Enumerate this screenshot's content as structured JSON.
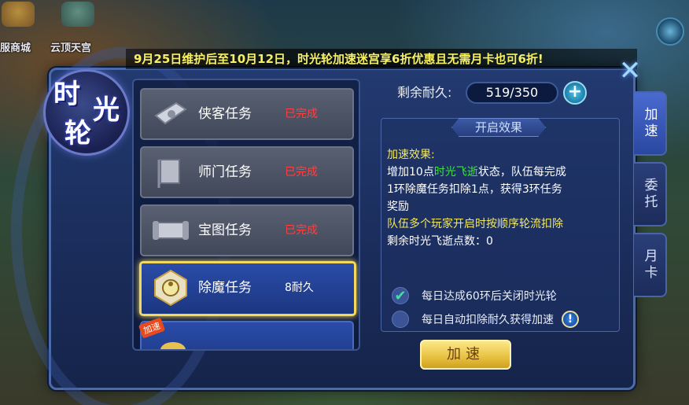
{
  "top_bar": {
    "left_labels": [
      "服商城",
      "云顶天宫"
    ]
  },
  "marquee": "9月25日维护后至10月12日，时光轮加速迷宫享6折优惠且无需月卡也可6折!",
  "title": {
    "chars": [
      "时",
      "光",
      "轮"
    ]
  },
  "tasks": [
    {
      "name": "侠客任务",
      "status": "已完成",
      "icon": "scroll-icon"
    },
    {
      "name": "师门任务",
      "status": "已完成",
      "icon": "banner-icon"
    },
    {
      "name": "宝图任务",
      "status": "已完成",
      "icon": "map-scroll-icon"
    },
    {
      "name": "除魔任务",
      "status": "8耐久",
      "icon": "taiji-icon"
    },
    {
      "name": "",
      "status": "",
      "icon": "gold-item-icon",
      "badge": "加速"
    }
  ],
  "durability": {
    "label": "剩余耐久:",
    "value": "519/350",
    "plus": "+"
  },
  "effect": {
    "title": "开启效果",
    "heading": "加速效果:",
    "line1_prefix": "增加10点",
    "line1_highlight": "时光飞逝",
    "line1_suffix": "状态，队伍每完成",
    "line2": "1环除魔任务扣除1点，获得3环任务",
    "line3": "奖励",
    "line4": "队伍多个玩家开启时按顺序轮流扣除",
    "line5": "剩余时光飞逝点数：0"
  },
  "options": [
    {
      "label": "每日达成60环后关闭时光轮",
      "checked": true
    },
    {
      "label": "每日自动扣除耐久获得加速",
      "checked": false
    }
  ],
  "info_icon": "!",
  "speed_button": "加速",
  "side_tabs": [
    "加速",
    "委托",
    "月卡"
  ],
  "close_glyph": "✕",
  "colors": {
    "accent_gold": "#f2d860",
    "completed_red": "#ff4040",
    "highlight_green": "#40e040",
    "text_yellow": "#f2e860"
  }
}
